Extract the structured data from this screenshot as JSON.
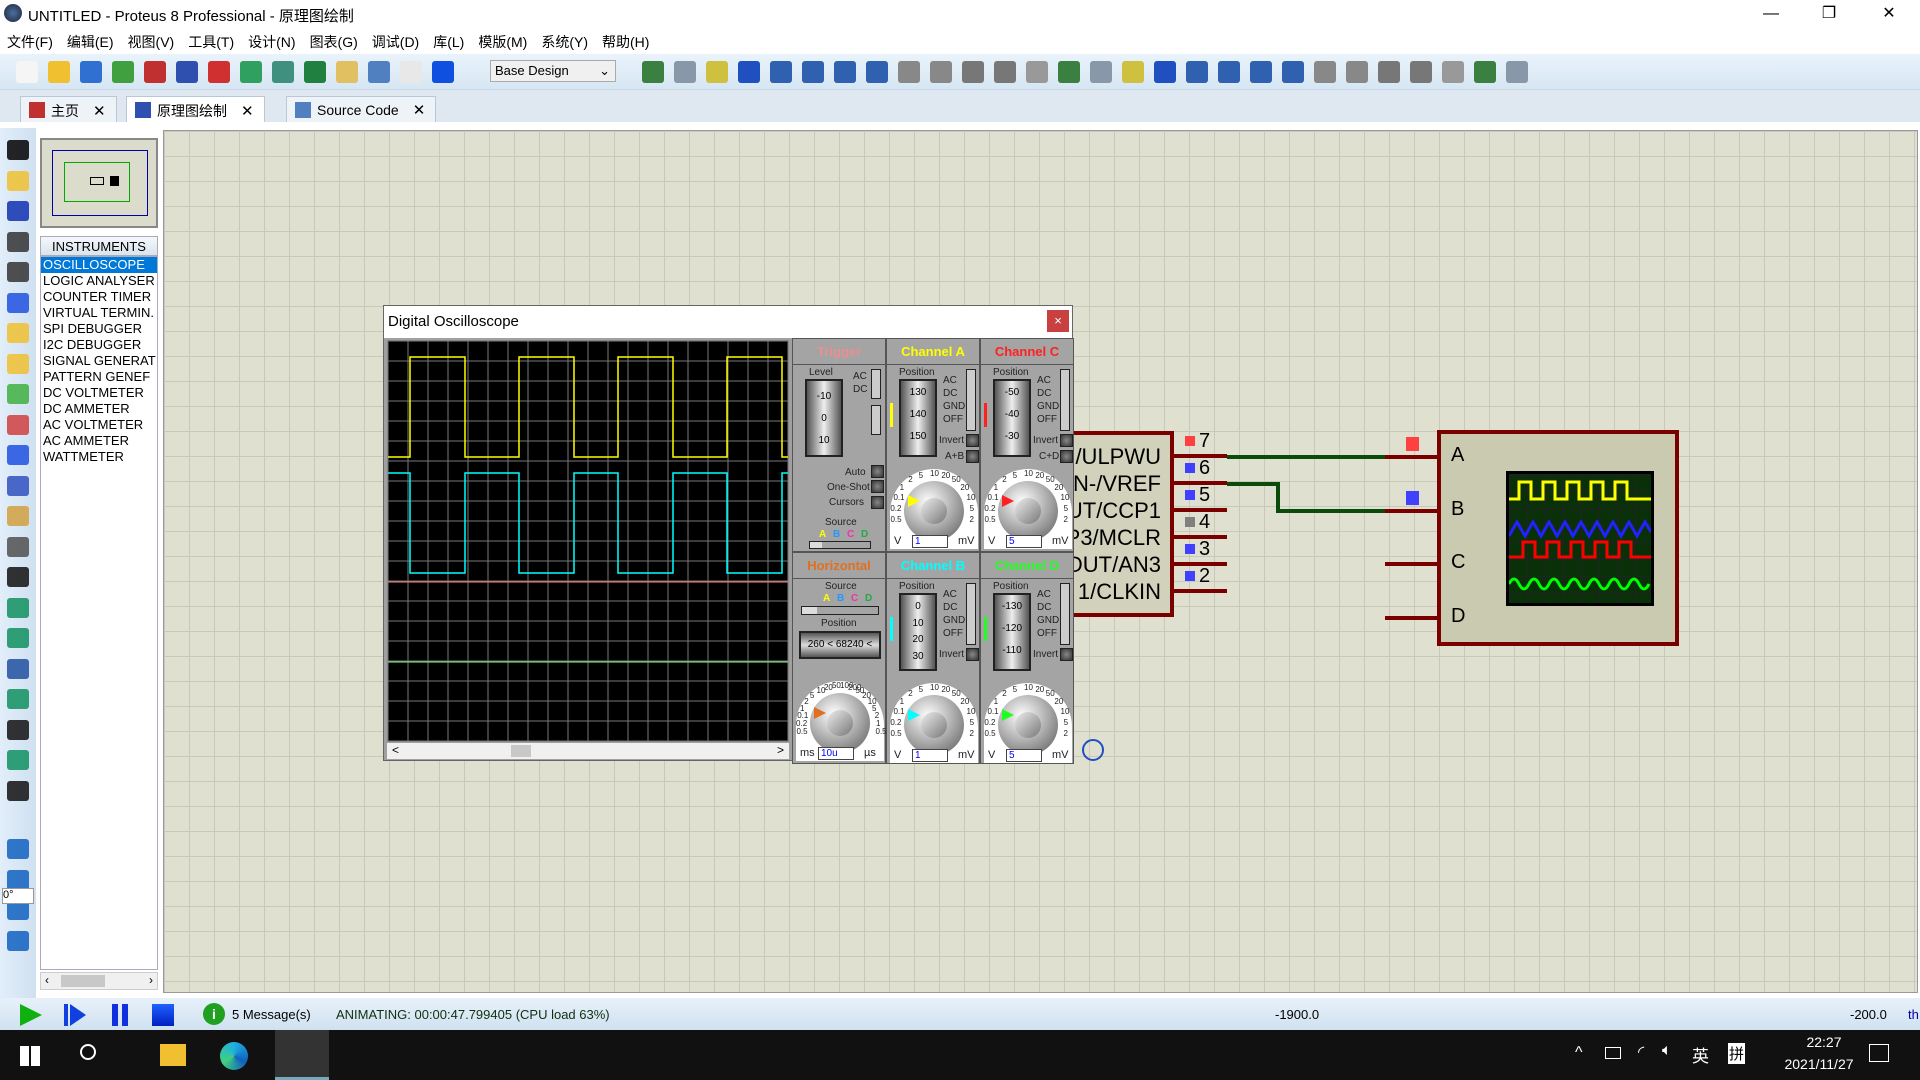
{
  "window": {
    "title": "UNTITLED - Proteus 8 Professional - 原理图绘制",
    "minimize": "—",
    "restore": "❐",
    "close": "✕"
  },
  "menu": [
    "文件(F)",
    "编辑(E)",
    "视图(V)",
    "工具(T)",
    "设计(N)",
    "图表(G)",
    "调试(D)",
    "库(L)",
    "模版(M)",
    "系统(Y)",
    "帮助(H)"
  ],
  "toolbar": {
    "icons": [
      "new-file-icon",
      "open-folder-icon",
      "save-icon",
      "import-icon",
      "home-icon",
      "schematic-icon",
      "pcb-icon",
      "3d-viewer-icon",
      "gerber-viewer-icon",
      "design-explorer-icon",
      "bill-of-materials-icon",
      "source-code-icon",
      "notes-icon",
      "help-icon"
    ],
    "design_select": "Base Design",
    "icons2": [
      "refresh-icon",
      "grid-icon",
      "origin-icon",
      "pan-icon",
      "zoom-in-icon",
      "zoom-out-icon",
      "zoom-all-icon",
      "zoom-area-icon",
      "undo-icon",
      "redo-icon",
      "cut-icon",
      "copy-icon",
      "paste-icon",
      "block-copy-icon",
      "block-move-icon",
      "block-rotate-icon",
      "block-delete-icon",
      "pick-device-icon",
      "make-device-icon",
      "decompose-icon",
      "packaging-tool-icon",
      "wire-autorouter-icon",
      "search-tag-icon",
      "property-assign-icon",
      "new-sheet-icon",
      "remove-sheet-icon",
      "goto-sheet-icon",
      "electrical-rule-check-icon"
    ],
    "colors": [
      "#f5f5f5",
      "#f0c030",
      "#3070d0",
      "#40a040",
      "#c03030",
      "#3050b0",
      "#d03030",
      "#30a060",
      "#409080",
      "#208040",
      "#e0c060",
      "#5080c0",
      "#e8e8e8",
      "#1050e0"
    ]
  },
  "tabs": [
    {
      "label": "主页",
      "close": "✕"
    },
    {
      "label": "原理图绘制",
      "close": "✕"
    },
    {
      "label": "Source Code",
      "close": "✕"
    }
  ],
  "left_tools": [
    "selection-mode-icon",
    "component-mode-icon",
    "junction-dot-icon",
    "wire-label-icon",
    "text-script-icon",
    "buses-icon",
    "subcircuit-icon",
    "terminals-icon",
    "device-pins-icon",
    "graph-icon",
    "active-popup-icon",
    "generator-icon",
    "probe-icon",
    "instrument-icon",
    "line-icon",
    "box-icon",
    "circle-icon",
    "arc-icon",
    "path-icon",
    "text-icon",
    "symbol-icon",
    "marker-icon",
    "rotate-cw-icon",
    "rotate-ccw-icon",
    "mirror-x-icon",
    "mirror-y-icon"
  ],
  "rotation_value": "0°",
  "instruments": {
    "header": "INSTRUMENTS",
    "items": [
      "OSCILLOSCOPE",
      "LOGIC ANALYSER",
      "COUNTER TIMER",
      "VIRTUAL TERMIN.",
      "SPI DEBUGGER",
      "I2C DEBUGGER",
      "SIGNAL GENERAT",
      "PATTERN GENEF",
      "DC VOLTMETER",
      "DC AMMETER",
      "AC VOLTMETER",
      "AC AMMETER",
      "WATTMETER"
    ],
    "selected": 0
  },
  "oscilloscope": {
    "title": "Digital Oscilloscope",
    "close": "×",
    "trace_colors": {
      "A": "#ffff00",
      "B": "#00ffff",
      "C": "#ff8080",
      "D": "#80ff80"
    },
    "trigger": {
      "header": "Trigger",
      "level_label": "Level",
      "drum": [
        "-10",
        "0",
        "10"
      ],
      "ac": "AC",
      "dc": "DC",
      "auto": "Auto",
      "one_shot": "One-Shot",
      "cursors": "Cursors",
      "source_label": "Source",
      "sources": [
        "A",
        "B",
        "C",
        "D"
      ]
    },
    "horizontal": {
      "header": "Horizontal",
      "source_label": "Source",
      "sources": [
        "A",
        "B",
        "C",
        "D"
      ],
      "position_label": "Position",
      "position_readout": "260  <  68240  <",
      "unit_left": "ms",
      "unit_right": "µs",
      "value": "10u",
      "scale": [
        "0.5",
        "0.2",
        "0.1",
        "1",
        "2",
        "5",
        "10",
        "20",
        "50",
        "100",
        "200",
        "50",
        "20",
        "10",
        "5",
        "2",
        "1",
        "0.5"
      ]
    },
    "channels": [
      {
        "id": "A",
        "header": "Channel A",
        "color": "#ffff00",
        "position_label": "Position",
        "drum": [
          "130",
          "140",
          "150"
        ],
        "modes": [
          "AC",
          "DC",
          "GND",
          "OFF"
        ],
        "invert": "Invert",
        "extra": "A+B",
        "value": "1",
        "unit_left": "V",
        "unit_right": "mV"
      },
      {
        "id": "C",
        "header": "Channel C",
        "color": "#ff2020",
        "position_label": "Position",
        "drum": [
          "-50",
          "-40",
          "-30"
        ],
        "modes": [
          "AC",
          "DC",
          "GND",
          "OFF"
        ],
        "invert": "Invert",
        "extra": "C+D",
        "value": "5",
        "unit_left": "V",
        "unit_right": "mV"
      },
      {
        "id": "B",
        "header": "Channel B",
        "color": "#00ffff",
        "position_label": "Position",
        "drum": [
          "0",
          "10",
          "20",
          "30"
        ],
        "modes": [
          "AC",
          "DC",
          "GND",
          "OFF"
        ],
        "invert": "Invert",
        "extra": "",
        "value": "1",
        "unit_left": "V",
        "unit_right": "mV"
      },
      {
        "id": "D",
        "header": "Channel D",
        "color": "#20ff20",
        "position_label": "Position",
        "drum": [
          "-130",
          "-120",
          "-110"
        ],
        "modes": [
          "AC",
          "DC",
          "GND",
          "OFF"
        ],
        "invert": "Invert",
        "extra": "",
        "value": "5",
        "unit_left": "V",
        "unit_right": "mV"
      }
    ],
    "volt_scale": [
      "0.5",
      "0.2",
      "0.1",
      "1",
      "2",
      "5",
      "10",
      "20",
      "50",
      "20",
      "10",
      "5",
      "2"
    ],
    "scroll_left": "<",
    "scroll_right": ">"
  },
  "schematic": {
    "chip_pins": [
      {
        "num": "7",
        "label": "/ULPWU",
        "marker": "#ff4040"
      },
      {
        "num": "6",
        "label": "N-/VREF",
        "marker": "#4040ff"
      },
      {
        "num": "5",
        "label": "UT/CCP1",
        "marker": "#4040ff"
      },
      {
        "num": "4",
        "label": "P3/MCLR",
        "marker": "#808080"
      },
      {
        "num": "3",
        "label": "OUT/AN3",
        "marker": "#4040ff"
      },
      {
        "num": "2",
        "label": "1/CLKIN",
        "marker": "#4040ff"
      }
    ],
    "scope_pins": [
      "A",
      "B",
      "C",
      "D"
    ],
    "scope_markers": {
      "A": "#ff4040",
      "B": "#4040ff"
    }
  },
  "status": {
    "messages": "5 Message(s)",
    "animating": "ANIMATING: 00:00:47.799405 (CPU load 63%)",
    "coord_x": "-1900.0",
    "coord_y": "-200.0",
    "units": "th"
  },
  "taskbar": {
    "time": "22:27",
    "date": "2021/11/27",
    "ime_lang": "英",
    "ime_mode": "拼"
  }
}
